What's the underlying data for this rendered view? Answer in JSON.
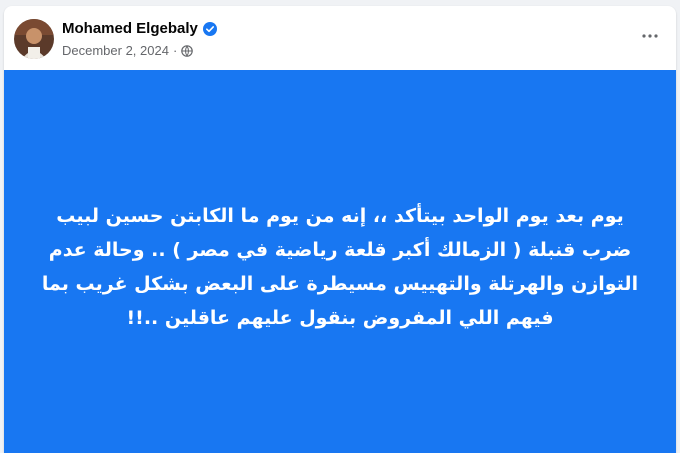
{
  "post": {
    "author": "Mohamed Elgebaly",
    "date": "December 2, 2024",
    "separator": "·",
    "audience_icon": "globe-icon",
    "verified_icon": "verified-badge-icon",
    "more_icon": "more-options-icon",
    "background_color": "#1877f2",
    "text_lines": [
      "يوم بعد يوم الواحد بيتأكد ،، إنه من يوم ما الكابتن حسين لبيب",
      "ضرب قنبلة ( الزمالك أكبر قلعة رياضية في مصر ) .. وحالة عدم",
      "التوازن والهرتلة والتهييس مسيطرة على البعض بشكل غريب بما",
      "فيهم اللي المفروض بنقول عليهم عاقلين ..!!"
    ]
  }
}
